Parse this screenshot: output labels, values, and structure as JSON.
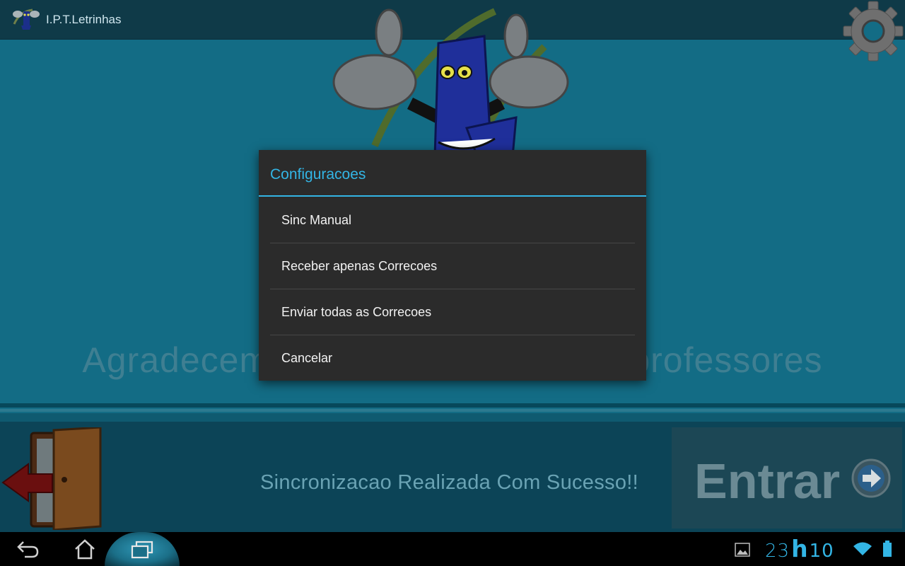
{
  "app": {
    "title": "I.P.T.Letrinhas",
    "welcome_text": "Agradecemos a colaboração dos professores",
    "sync_status": "Sincronizacao Realizada Com Sucesso!!",
    "enter_label": "Entrar"
  },
  "dialog": {
    "title": "Configuracoes",
    "items": [
      {
        "label": "Sinc Manual"
      },
      {
        "label": "Receber apenas Correcoes"
      },
      {
        "label": "Enviar todas as Correcoes"
      },
      {
        "label": "Cancelar"
      }
    ]
  },
  "statusbar": {
    "clock_hours": "23",
    "clock_sep": "h",
    "clock_minutes": "10"
  },
  "colors": {
    "accent": "#33b5e5",
    "background": "#136c85",
    "dialog_bg": "#2b2b2b"
  }
}
